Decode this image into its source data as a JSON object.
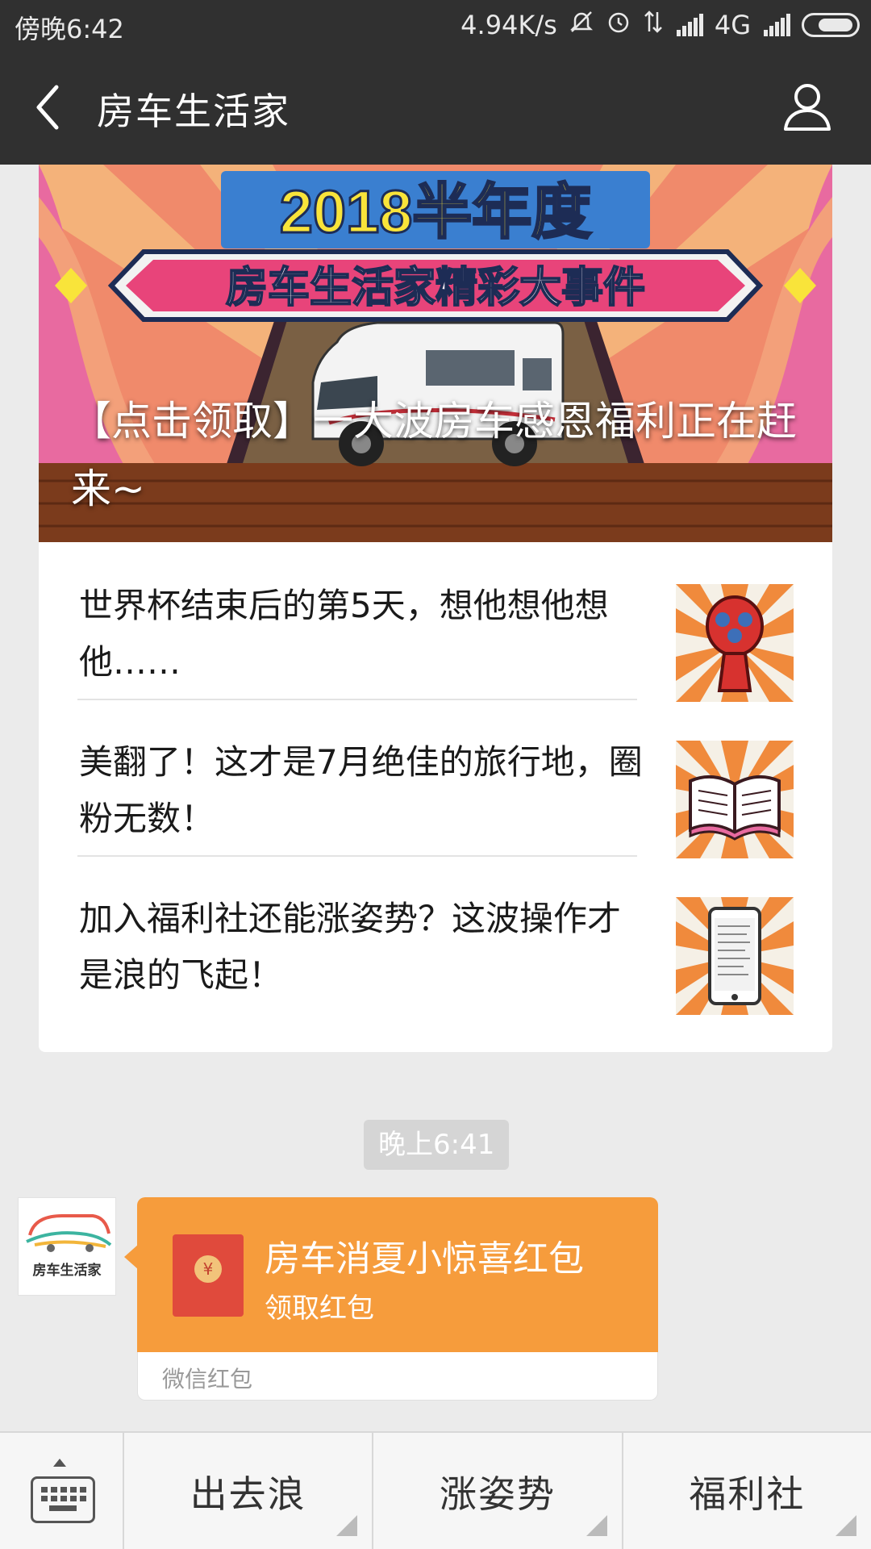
{
  "status_bar": {
    "time": "傍晚6:42",
    "net_speed": "4.94K/s",
    "network": "4G"
  },
  "header": {
    "back_icon": "chevron-left-icon",
    "title": "房车生活家",
    "profile_icon": "person-icon"
  },
  "article_card": {
    "cover": {
      "banner_year": "2018半年度",
      "banner_subtitle": "房车生活家精彩大事件",
      "headline": "【点击领取】一大波房车感恩福利正在赶来~"
    },
    "articles": [
      {
        "title": "世界杯结束后的第5天，想他想他想他……",
        "thumb": "world-cup-trophy-icon"
      },
      {
        "title": "美翻了！这才是7月绝佳的旅行地，圈粉无数！",
        "thumb": "open-book-icon"
      },
      {
        "title": "加入福利社还能涨姿势？这波操作才是浪的飞起！",
        "thumb": "smartphone-icon"
      }
    ]
  },
  "timestamp": "晚上6:41",
  "message": {
    "avatar_label": "房车生活家",
    "red_packet": {
      "title": "房车消夏小惊喜红包",
      "action": "领取红包",
      "source": "微信红包"
    }
  },
  "bottom_menu": {
    "keyboard_icon": "keyboard-icon",
    "items": [
      "出去浪",
      "涨姿势",
      "福利社"
    ]
  },
  "colors": {
    "header_bg": "#303030",
    "red_packet": "#f69c3c",
    "envelope": "#e04a3c"
  }
}
